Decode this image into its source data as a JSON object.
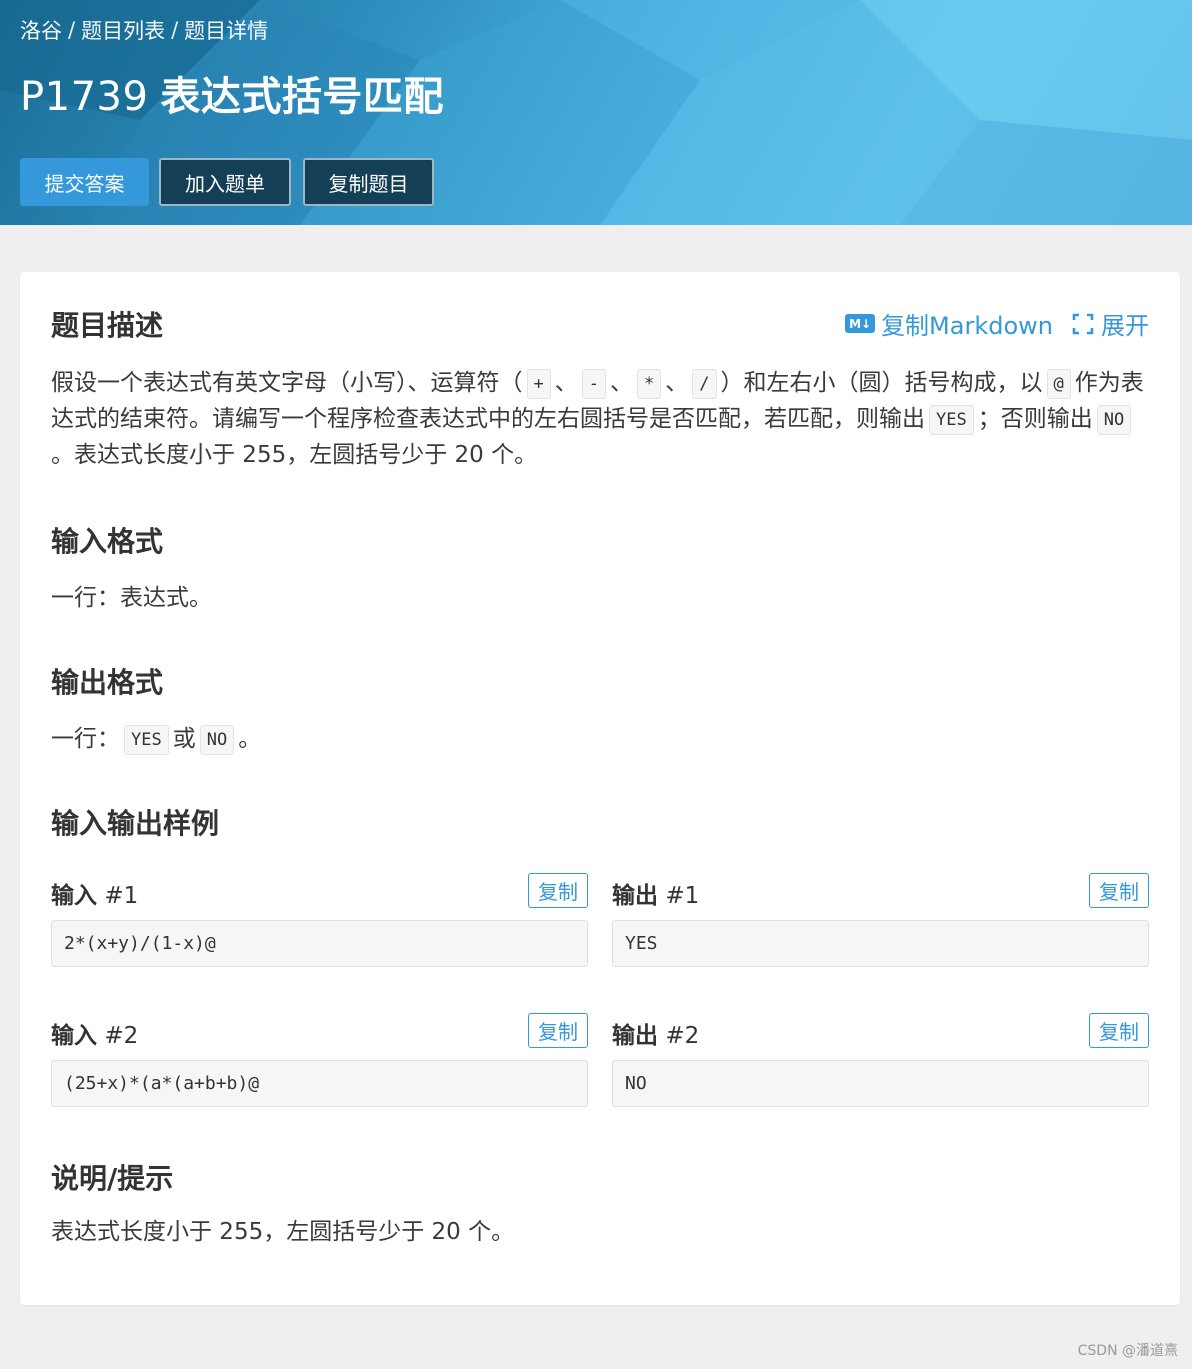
{
  "header": {
    "breadcrumb": [
      "洛谷",
      "题目列表",
      "题目详情"
    ],
    "breadcrumb_sep": "/",
    "problem_id": "P1739",
    "problem_title": "表达式括号匹配",
    "buttons": {
      "submit": "提交答案",
      "add_to_list": "加入题单",
      "copy_problem": "复制题目"
    }
  },
  "tools": {
    "copy_markdown": "复制Markdown",
    "md_badge": "M↓",
    "expand": "展开"
  },
  "sections": {
    "description": {
      "heading": "题目描述",
      "p1": "假设一个表达式有英文字母（小写）、运算符（",
      "op1": "+",
      "sep": "、",
      "op2": "-",
      "op3": "*",
      "op4": "/",
      "p2": "）和左右小（圆）括号构成，以",
      "at": "@",
      "p3": "作为表达式的结束符。请编写一个程序检查表达式中的左右圆括号是否匹配，若匹配，则输出",
      "yes": "YES",
      "p4": "；否则输出",
      "no": "NO",
      "p5": "。表达式长度小于 255，左圆括号少于 20 个。"
    },
    "input_format": {
      "heading": "输入格式",
      "text": "一行：表达式。"
    },
    "output_format": {
      "heading": "输出格式",
      "t1": "一行：",
      "yes": "YES",
      "t2": "或",
      "no": "NO",
      "t3": "。"
    },
    "samples": {
      "heading": "输入输出样例",
      "input_label": "输入",
      "output_label": "输出",
      "copy": "复制",
      "items": [
        {
          "num": "#1",
          "input": "2*(x+y)/(1-x)@",
          "output": "YES"
        },
        {
          "num": "#2",
          "input": "(25+x)*(a*(a+b+b)@",
          "output": "NO"
        }
      ]
    },
    "hint": {
      "heading": "说明/提示",
      "text": "表达式长度小于 255，左圆括号少于 20 个。"
    }
  },
  "watermark": "CSDN @潘道熹",
  "colors": {
    "accent": "#3498db",
    "dark_button": "#153f57",
    "banner_start": "#1a6e96",
    "banner_end": "#63c6ee"
  }
}
